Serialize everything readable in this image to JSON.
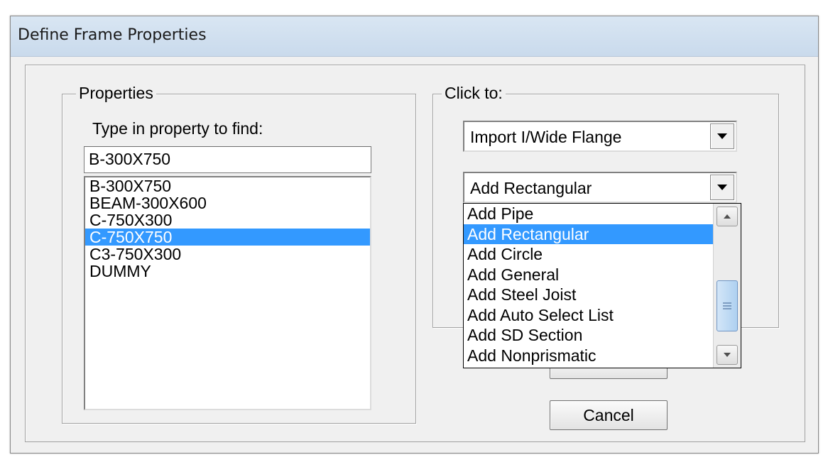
{
  "window": {
    "title": "Define Frame Properties"
  },
  "properties": {
    "legend": "Properties",
    "find_label": "Type in property to find:",
    "find_value": "B-300X750",
    "items": [
      "B-300X750",
      "BEAM-300X600",
      "C-750X300",
      "C-750X750",
      "C3-750X300",
      "DUMMY"
    ],
    "selected_index": 3
  },
  "click_to": {
    "legend": "Click to:",
    "import_combo": "Import I/Wide Flange",
    "add_combo": "Add Rectangular",
    "dropdown_items": [
      "Add Pipe",
      "Add Rectangular",
      "Add Circle",
      "Add General",
      "Add Steel Joist",
      "Add Auto Select List",
      "Add SD Section",
      "Add Nonprismatic"
    ],
    "dropdown_selected_index": 1
  },
  "buttons": {
    "cancel": "Cancel"
  }
}
